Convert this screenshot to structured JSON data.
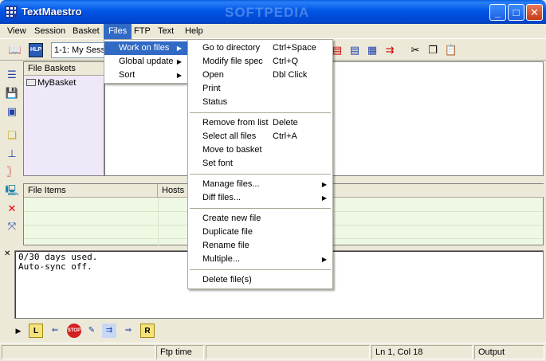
{
  "window": {
    "title": "TextMaestro",
    "watermark": "SOFTPEDIA",
    "min_glyph": "_",
    "max_glyph": "□",
    "close_glyph": "✕"
  },
  "menubar": {
    "items": [
      "View",
      "Session",
      "Basket",
      "Files",
      "FTP",
      "Text",
      "Help"
    ],
    "active": "Files"
  },
  "toolbar": {
    "session_combo": "1-1: My Session"
  },
  "files_menu": {
    "items": [
      {
        "label": "Work on files",
        "submenu": true,
        "highlighted": true
      },
      {
        "label": "Global update",
        "submenu": true
      },
      {
        "label": "Sort",
        "submenu": true
      }
    ]
  },
  "work_menu": {
    "group1": [
      {
        "label": "Go to directory",
        "shortcut": "Ctrl+Space"
      },
      {
        "label": "Modify file spec",
        "shortcut": "Ctrl+Q"
      },
      {
        "label": "Open",
        "shortcut": "Dbl Click"
      },
      {
        "label": "Print",
        "shortcut": ""
      },
      {
        "label": "Status",
        "shortcut": ""
      }
    ],
    "group2": [
      {
        "label": "Remove from list",
        "shortcut": "Delete"
      },
      {
        "label": "Select all files",
        "shortcut": "Ctrl+A"
      },
      {
        "label": "Move to basket",
        "shortcut": ""
      },
      {
        "label": "Set font",
        "shortcut": ""
      }
    ],
    "group3": [
      {
        "label": "Manage files...",
        "submenu": true
      },
      {
        "label": "Diff files...",
        "submenu": true
      }
    ],
    "group4": [
      {
        "label": "Create new file",
        "submenu": false
      },
      {
        "label": "Duplicate file",
        "submenu": false
      },
      {
        "label": "Rename file",
        "submenu": false
      },
      {
        "label": "Multiple...",
        "submenu": true
      }
    ],
    "group5": [
      {
        "label": "Delete file(s)"
      }
    ]
  },
  "baskets": {
    "header": "File Baskets",
    "items": [
      "MyBasket"
    ]
  },
  "file_items": {
    "headers": [
      "File Items",
      "Hosts"
    ]
  },
  "output": {
    "lines": [
      "0/30 days used.",
      "Auto-sync off."
    ]
  },
  "statusbar": {
    "ftp": "Ftp time",
    "position": "Ln 1, Col 18",
    "panel": "Output"
  },
  "colors": {
    "titlebar": "#0055E5",
    "menu_highlight": "#316AC5",
    "baskets_bg": "#EEE8F9",
    "items_bg": "#EFF8E4"
  }
}
